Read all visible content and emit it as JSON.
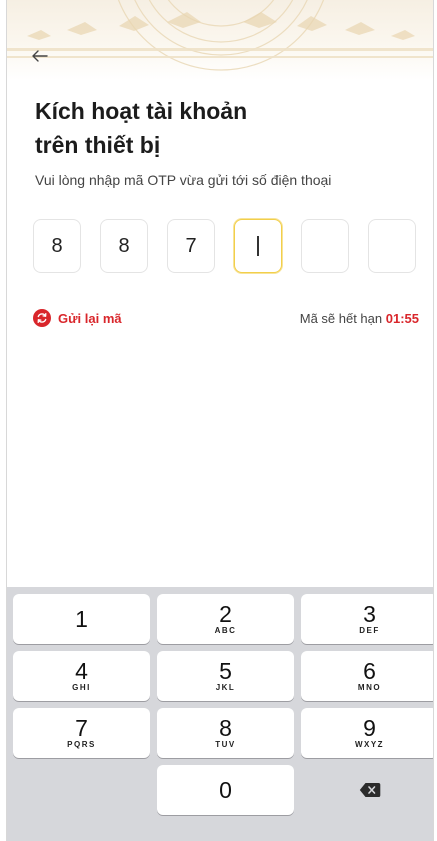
{
  "header": {
    "back_icon": "arrow-left-icon",
    "title_line1": "Kích hoạt tài khoản",
    "title_line2": "trên thiết bị",
    "subtitle": "Vui lòng nhập mã OTP vừa gửi tới số điện thoại"
  },
  "otp": {
    "digits": [
      "8",
      "8",
      "7",
      "",
      "",
      ""
    ],
    "active_index": 3
  },
  "resend": {
    "icon": "refresh-icon",
    "label": "Gửi lại mã"
  },
  "expiry": {
    "label": "Mã sẽ hết hạn",
    "time": "01:55"
  },
  "keypad": {
    "keys": [
      {
        "digit": "1",
        "letters": ""
      },
      {
        "digit": "2",
        "letters": "ABC"
      },
      {
        "digit": "3",
        "letters": "DEF"
      },
      {
        "digit": "4",
        "letters": "GHI"
      },
      {
        "digit": "5",
        "letters": "JKL"
      },
      {
        "digit": "6",
        "letters": "MNO"
      },
      {
        "digit": "7",
        "letters": "PQRS"
      },
      {
        "digit": "8",
        "letters": "TUV"
      },
      {
        "digit": "9",
        "letters": "WXYZ"
      },
      {
        "digit": "0",
        "letters": ""
      }
    ],
    "delete_icon": "backspace-icon"
  },
  "colors": {
    "accent": "#d9262b",
    "active_border": "#f2cf4a",
    "keypad_bg": "#d6d7db"
  }
}
